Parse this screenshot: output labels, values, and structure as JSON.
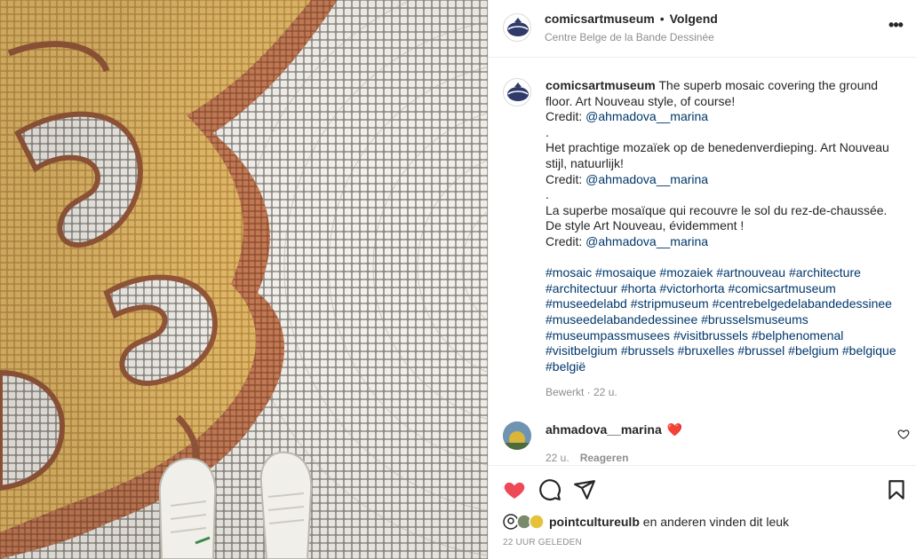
{
  "post": {
    "account": "comicsartmuseum",
    "separator": "•",
    "follow_label": "Volgend",
    "location": "Centre Belge de la Bande Dessinée",
    "more_icon": "more-dots-icon"
  },
  "caption": {
    "username": "comicsartmuseum",
    "lines": [
      {
        "text": "The superb mosaic covering the ground floor. Art Nouveau style, of course!"
      },
      {
        "prefix": "Credit: ",
        "mention": "@ahmadova__marina"
      },
      {
        "text": "."
      },
      {
        "text": "Het prachtige mozaïek op de benedenverdieping. Art Nouveau stijl, natuurlijk!"
      },
      {
        "prefix": "Credit: ",
        "mention": "@ahmadova__marina"
      },
      {
        "text": "."
      },
      {
        "text": "La superbe mosaïque qui recouvre le sol du rez-de-chaussée. De style Art Nouveau, évidemment !"
      },
      {
        "prefix": "Credit: ",
        "mention": "@ahmadova__marina"
      }
    ],
    "hashtags": [
      "#mosaic",
      "#mosaique",
      "#mozaiek",
      "#artnouveau",
      "#architecture",
      "#architectuur",
      "#horta",
      "#victorhorta",
      "#comicsartmuseum",
      "#museedelabd",
      "#stripmuseum",
      "#centrebelgedelabandedessinee",
      "#museedelabandedessinee",
      "#brusselsmuseums",
      "#museumpassmusees",
      "#visitbrussels",
      "#belphenomenal",
      "#visitbelgium",
      "#brussels",
      "#bruxelles",
      "#brussel",
      "#belgium",
      "#belgique",
      "#belgië"
    ],
    "edited": "Bewerkt · 22 u."
  },
  "comment": {
    "username": "ahmadova__marina",
    "emoji": "❤️",
    "time": "22 u.",
    "reply_label": "Reageren"
  },
  "actions": {
    "like_icon": "heart-filled-icon",
    "comment_icon": "comment-icon",
    "share_icon": "share-paper-plane-icon",
    "save_icon": "bookmark-icon",
    "like_color": "#ed4956"
  },
  "likes": {
    "liker": "pointcultureulb",
    "rest": " en anderen vinden dit leuk"
  },
  "timestamp": "22 UUR GELEDEN"
}
